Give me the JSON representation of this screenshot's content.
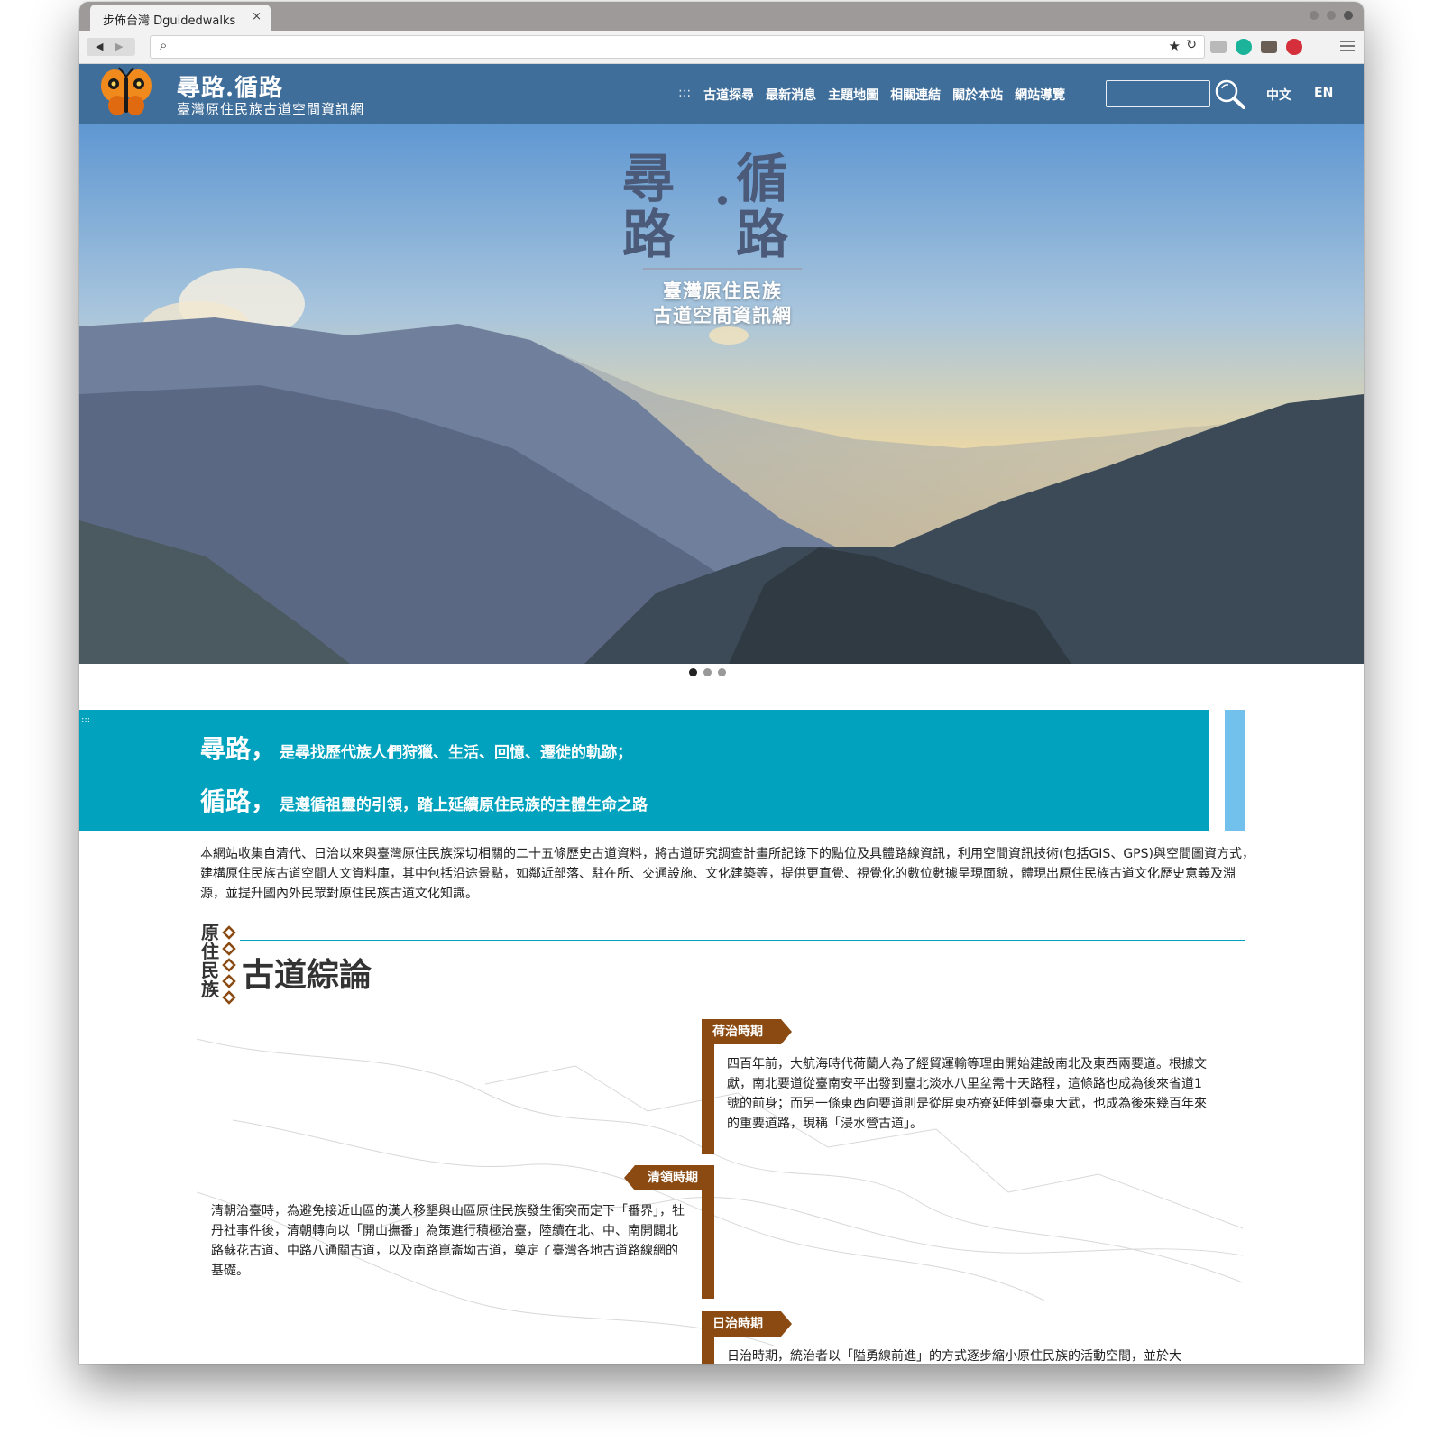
{
  "browser": {
    "tab_title": "步佈台灣 Dguidedwalks",
    "tab_close": "×",
    "nav_back": "◀",
    "nav_forward": "▶",
    "url_search_glyph": "⌕",
    "bookmark_glyph": "★",
    "reload_glyph": "↻"
  },
  "site": {
    "title": "尋路.循路",
    "subtitle": "臺灣原住民族古道空間資訊網",
    "nav_accesskey": ":::",
    "nav": [
      "古道探尋",
      "最新消息",
      "主題地圖",
      "相關連結",
      "關於本站",
      "網站導覽"
    ],
    "search_placeholder": "",
    "lang_zh": "中文",
    "lang_en": "EN"
  },
  "hero": {
    "col1": [
      "尋",
      "路"
    ],
    "col2": [
      "循",
      "路"
    ],
    "sub_line1": "臺灣原住民族",
    "sub_line2": "古道空間資訊網",
    "slides": 3,
    "active_slide": 1
  },
  "banner": {
    "accesskey": ":::",
    "line1_big": "尋路，",
    "line1_small": "是尋找歷代族人們狩獵、生活、回憶、遷徙的軌跡；",
    "line2_big": "循路，",
    "line2_small": "是遵循祖靈的引領，踏上延續原住民族的主體生命之路",
    "color": "#00a2bd",
    "side_color": "#72c0ec"
  },
  "intro": "本網站收集自清代、日治以來與臺灣原住民族深切相關的二十五條歷史古道資料，將古道研究調查計畫所記錄下的點位及具體路線資訊，利用空間資訊技術(包括GIS、GPS)與空間圖資方式，建構原住民族古道空間人文資料庫，其中包括沿途景點，如鄰近部落、駐在所、交通設施、文化建築等，提供更直覺、視覺化的數位數據呈現面貌，體現出原住民族古道文化歷史意義及淵源，並提升國內外民眾對原住民族古道文化知識。",
  "section": {
    "vertical_label": "原住民族",
    "title": "古道綜論"
  },
  "timeline": {
    "color": "#8a4a12",
    "periods": [
      {
        "label": "荷治時期",
        "text": "四百年前，大航海時代荷蘭人為了經貿運輸等理由開始建設南北及東西兩要道。根據文獻，南北要道從臺南安平出發到臺北淡水八里坌需十天路程，這條路也成為後來省道1號的前身；而另一條東西向要道則是從屏東枋寮延伸到臺東大武，也成為後來幾百年來的重要道路，現稱「浸水營古道」。"
      },
      {
        "label": "清領時期",
        "text": "清朝治臺時，為避免接近山區的漢人移墾與山區原住民族發生衝突而定下「番界」，牡丹社事件後，清朝轉向以「開山撫番」為策進行積極治臺，陸續在北、中、南開闢北路蘇花古道、中路八通關古道，以及南路崑崙坳古道，奠定了臺灣各地古道路線網的基礎。"
      },
      {
        "label": "日治時期",
        "text": "日治時期，統治者以「隘勇線前進」的方式逐步縮小原住民族的活動空間，並於大"
      }
    ]
  }
}
